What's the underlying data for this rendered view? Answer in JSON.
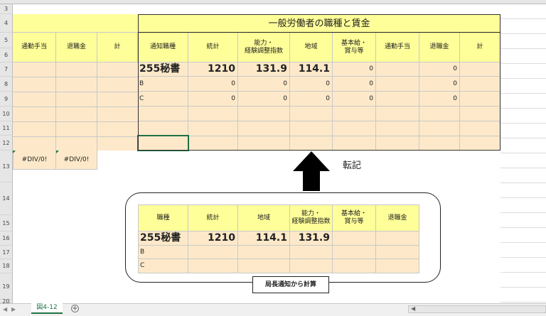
{
  "sheet": {
    "row_numbers": [
      "3",
      "4",
      "5",
      "6",
      "7",
      "8",
      "9",
      "10",
      "11",
      "12",
      "13",
      "14",
      "15",
      "16",
      "17",
      "18",
      "19",
      "20"
    ],
    "title": "一般労働者の職種と賃金",
    "left_headers": [
      "通勤手当",
      "退職金",
      "計"
    ],
    "main_headers": [
      "通知職種",
      "統計",
      "能力・\n経験調整指数",
      "地域",
      "基本給・\n賞与等",
      "通勤手当",
      "退職金",
      "計"
    ],
    "row1": {
      "job": "255秘書",
      "stat": "1210",
      "ability": "131.9",
      "area": "114.1",
      "base": "0",
      "commute": "",
      "retire": "0"
    },
    "row2": {
      "job": "B",
      "stat": "0",
      "ability": "0",
      "area": "0",
      "base": "0",
      "commute": "",
      "retire": "0"
    },
    "row3": {
      "job": "C",
      "stat": "0",
      "ability": "0",
      "area": "0",
      "base": "0",
      "commute": "",
      "retire": "0"
    },
    "div_errors": [
      "#DIV/0!",
      "#DIV/0!"
    ],
    "transfer_label": "転記",
    "lower_headers": [
      "職種",
      "統計",
      "地域",
      "能力・\n経験調整指数",
      "基本給・\n賞与等",
      "退職金"
    ],
    "lower_row1": {
      "job": "255秘書",
      "stat": "1210",
      "area": "114.1",
      "ability": "131.9"
    },
    "lower_row2": "B",
    "lower_row3": "C",
    "calc_label": "局長通知から計算",
    "sheet_tab": "図4-12",
    "add_sheet_icon": "plus-circle-icon"
  }
}
